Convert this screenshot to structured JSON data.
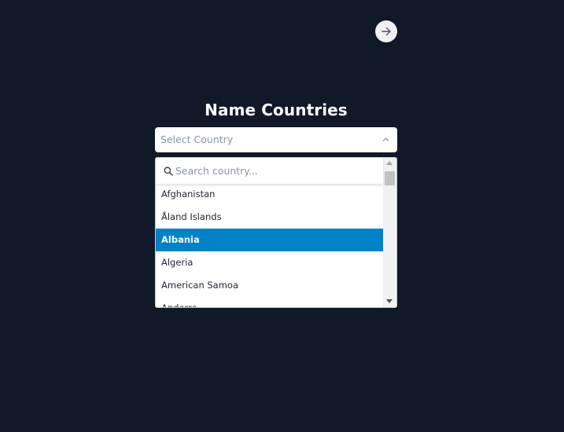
{
  "nav": {
    "next_icon": "arrow-right-icon"
  },
  "form": {
    "title": "Name Countries",
    "select": {
      "placeholder": "Select Country",
      "chevron_icon": "chevron-up-icon",
      "expanded": true
    },
    "dropdown": {
      "search_placeholder": "Search country...",
      "search_value": "",
      "search_icon": "search-icon",
      "options": [
        "Afghanistan",
        "Åland Islands",
        "Albania",
        "Algeria",
        "American Samoa",
        "Andorra"
      ],
      "highlighted_option": "Albania"
    }
  },
  "colors": {
    "background": "#111827",
    "highlight": "#0082c8",
    "surface": "#ffffff",
    "muted_text": "#8b93a3"
  }
}
